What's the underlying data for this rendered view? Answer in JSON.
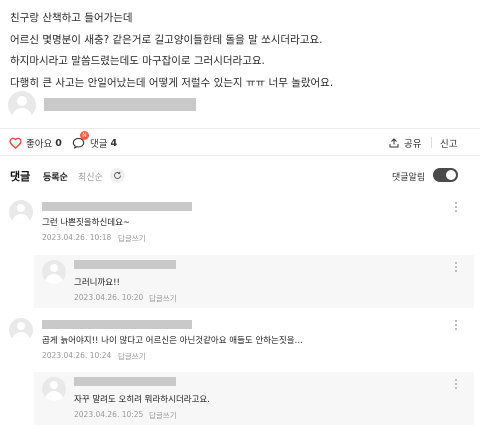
{
  "post": {
    "lines": [
      "친구랑 산책하고 들어가는데",
      "어르신 몇명분이 새충? 같은거로 길고양이들한테 돌을 말 쏘시더라고요.",
      "하지마시라고 말씀드렸는데도 마구잡이로 그러시더라고요.",
      "다행히 큰 사고는 안일어났는데 어떻게 저럴수 있는지 ㅠㅠ 너무 놀랐어요."
    ]
  },
  "actions": {
    "like_label": "좋아요",
    "like_count": "0",
    "comment_label": "댓글",
    "comment_count": "4",
    "comment_badge": "N",
    "share_label": "공유",
    "report_label": "신고"
  },
  "comments_header": {
    "title": "댓글",
    "sort_registered": "등록순",
    "sort_latest": "최신순",
    "alarm_label": "댓글알림"
  },
  "comments": [
    {
      "text": "그런 나쁜짓을하신데요~",
      "date": "2023.04.26. 10:18",
      "reply_label": "답글쓰기"
    },
    {
      "text": "그러니까요!!",
      "date": "2023.04.26. 10:20",
      "reply_label": "답글쓰기"
    },
    {
      "text": "곱게 늙어야지!! 나이 많다고 어르신은 아닌것같아요 애들도 안하는짓을…",
      "date": "2023.04.26. 10:24",
      "reply_label": "답글쓰기"
    },
    {
      "text": "자꾸 말려도 오히려 뭐라하시더라고요.",
      "date": "2023.04.26. 10:25",
      "reply_label": "답글쓰기"
    }
  ],
  "colors": {
    "heart": "#e8413a",
    "badge": "#ff5a3c",
    "toggle_bg": "#4a4a4a",
    "redacted_bar": "#c9c9c9"
  }
}
